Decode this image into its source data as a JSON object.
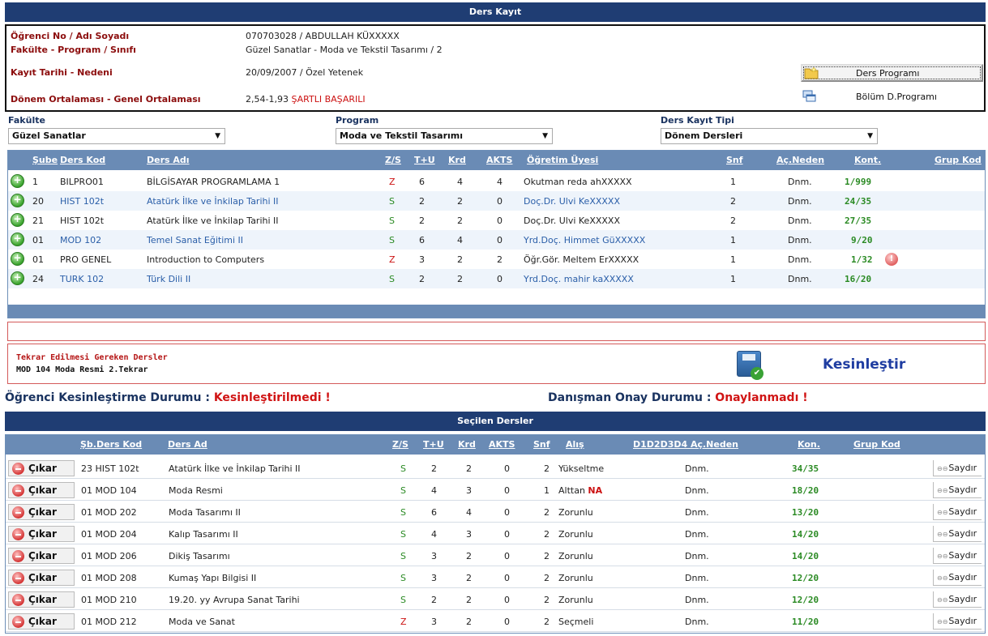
{
  "header": {
    "title": "Ders Kayıt"
  },
  "student": {
    "rows": [
      {
        "label": "Öğrenci No / Adı Soyadı",
        "value": "070703028 / ABDULLAH KÜXXXXX",
        "value_red": ""
      },
      {
        "label": "Fakülte - Program / Sınıfı",
        "value": "Güzel Sanatlar - Moda ve Tekstil Tasarımı / 2",
        "value_red": ""
      },
      {
        "label": "Kayıt Tarihi - Nedeni",
        "value": "20/09/2007 / Özel Yetenek",
        "value_red": ""
      },
      {
        "label": "Dönem Ortalaması - Genel Ortalaması",
        "value": "2,54-1,93",
        "value_red": "ŞARTLI BAŞARILI"
      }
    ],
    "buttons": {
      "program": "Ders Programı",
      "department": "Bölüm D.Programı"
    }
  },
  "filters": {
    "faculty": {
      "label": "Fakülte",
      "value": "Güzel Sanatlar"
    },
    "program": {
      "label": "Program",
      "value": "Moda ve Tekstil Tasarımı"
    },
    "type": {
      "label": "Ders Kayıt Tipi",
      "value": "Dönem Dersleri"
    }
  },
  "courses": {
    "headers": [
      "Şube",
      "Ders Kod",
      "Ders Adı",
      "Z/S",
      "T+U",
      "Krd",
      "AKTS",
      "Öğretim Üyesi",
      "Snf",
      "Aç.Neden",
      "Kont.",
      "Grup Kod"
    ],
    "rows": [
      {
        "sube": "1",
        "kod": "BILPRO01",
        "ad": "BİLGİSAYAR PROGRAMLAMA 1",
        "zs": "Z",
        "tu": "6",
        "krd": "4",
        "akts": "4",
        "ogr": "Okutman reda ahXXXXX",
        "snf": "1",
        "neden": "Dnm.",
        "kont": "1/999",
        "warn": false
      },
      {
        "sube": "20",
        "kod": "HIST 102t",
        "ad": "Atatürk İlke ve İnkilap Tarihi II",
        "zs": "S",
        "tu": "2",
        "krd": "2",
        "akts": "0",
        "ogr": "Doç.Dr. Ulvi KeXXXXX",
        "snf": "2",
        "neden": "Dnm.",
        "kont": "24/35",
        "warn": false
      },
      {
        "sube": "21",
        "kod": "HIST 102t",
        "ad": "Atatürk İlke ve İnkilap Tarihi II",
        "zs": "S",
        "tu": "2",
        "krd": "2",
        "akts": "0",
        "ogr": "Doç.Dr. Ulvi KeXXXXX",
        "snf": "2",
        "neden": "Dnm.",
        "kont": "27/35",
        "warn": false
      },
      {
        "sube": "01",
        "kod": "MOD 102",
        "ad": "Temel Sanat Eğitimi II",
        "zs": "S",
        "tu": "6",
        "krd": "4",
        "akts": "0",
        "ogr": "Yrd.Doç. Himmet GüXXXXX",
        "snf": "1",
        "neden": "Dnm.",
        "kont": "9/20",
        "warn": false
      },
      {
        "sube": "01",
        "kod": "PRO GENEL",
        "ad": "Introduction to Computers",
        "zs": "Z",
        "tu": "3",
        "krd": "2",
        "akts": "2",
        "ogr": "Öğr.Gör. Meltem ErXXXXX",
        "snf": "1",
        "neden": "Dnm.",
        "kont": "1/32",
        "warn": true
      },
      {
        "sube": "24",
        "kod": "TURK 102",
        "ad": "Türk Dili II",
        "zs": "S",
        "tu": "2",
        "krd": "2",
        "akts": "0",
        "ogr": "Yrd.Doç. mahir kaXXXXX",
        "snf": "1",
        "neden": "Dnm.",
        "kont": "16/20",
        "warn": false
      }
    ]
  },
  "repeat": {
    "title": "Tekrar Edilmesi Gereken Dersler",
    "item": "MOD 104 Moda Resmi 2.Tekrar",
    "confirm": "Kesinleştir"
  },
  "status": {
    "student_label": "Öğrenci Kesinleştirme Durumu :",
    "student_value": "Kesinleştirilmedi !",
    "advisor_label": "Danışman Onay Durumu :",
    "advisor_value": "Onaylanmadı !"
  },
  "selected": {
    "title": "Seçilen Dersler",
    "headers": [
      "Şb.Ders Kod",
      "Ders Ad",
      "Z/S",
      "T+U",
      "Krd",
      "AKTS",
      "Snf",
      "Alış",
      "D1D2D3D4 Aç.Neden",
      "Kon.",
      "Grup Kod"
    ],
    "remove_label": "Çıkar",
    "count_label": "Saydır",
    "rows": [
      {
        "sbkod": "23 HIST 102t",
        "ad": "Atatürk İlke ve İnkilap Tarihi II",
        "zs": "S",
        "tu": "2",
        "krd": "2",
        "akts": "0",
        "snf": "2",
        "alis": "Yükseltme",
        "alis_tag": "",
        "neden": "Dnm.",
        "kon": "34/35"
      },
      {
        "sbkod": "01 MOD 104",
        "ad": "Moda Resmi",
        "zs": "S",
        "tu": "4",
        "krd": "3",
        "akts": "0",
        "snf": "1",
        "alis": "Alttan",
        "alis_tag": "NA",
        "neden": "Dnm.",
        "kon": "18/20"
      },
      {
        "sbkod": "01 MOD 202",
        "ad": "Moda Tasarımı II",
        "zs": "S",
        "tu": "6",
        "krd": "4",
        "akts": "0",
        "snf": "2",
        "alis": "Zorunlu",
        "alis_tag": "",
        "neden": "Dnm.",
        "kon": "13/20"
      },
      {
        "sbkod": "01 MOD 204",
        "ad": "Kalıp Tasarımı II",
        "zs": "S",
        "tu": "4",
        "krd": "3",
        "akts": "0",
        "snf": "2",
        "alis": "Zorunlu",
        "alis_tag": "",
        "neden": "Dnm.",
        "kon": "14/20"
      },
      {
        "sbkod": "01 MOD 206",
        "ad": "Dikiş Tasarımı",
        "zs": "S",
        "tu": "3",
        "krd": "2",
        "akts": "0",
        "snf": "2",
        "alis": "Zorunlu",
        "alis_tag": "",
        "neden": "Dnm.",
        "kon": "14/20"
      },
      {
        "sbkod": "01 MOD 208",
        "ad": "Kumaş Yapı Bilgisi II",
        "zs": "S",
        "tu": "3",
        "krd": "2",
        "akts": "0",
        "snf": "2",
        "alis": "Zorunlu",
        "alis_tag": "",
        "neden": "Dnm.",
        "kon": "12/20"
      },
      {
        "sbkod": "01 MOD 210",
        "ad": "19.20. yy Avrupa Sanat Tarihi",
        "zs": "S",
        "tu": "2",
        "krd": "2",
        "akts": "0",
        "snf": "2",
        "alis": "Zorunlu",
        "alis_tag": "",
        "neden": "Dnm.",
        "kon": "12/20"
      },
      {
        "sbkod": "01 MOD 212",
        "ad": "Moda ve Sanat",
        "zs": "Z",
        "tu": "3",
        "krd": "2",
        "akts": "0",
        "snf": "2",
        "alis": "Seçmeli",
        "alis_tag": "",
        "neden": "Dnm.",
        "kon": "11/20"
      }
    ]
  }
}
